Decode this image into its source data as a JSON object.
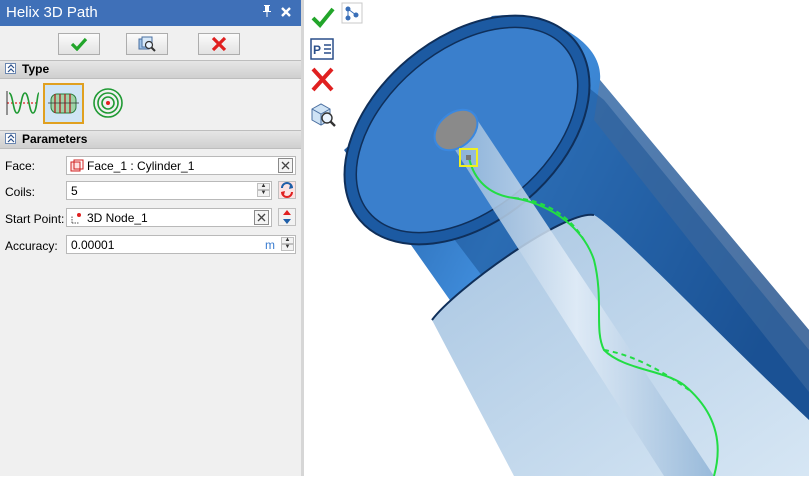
{
  "panel": {
    "title": "Helix 3D Path",
    "pin_glyph": "p",
    "close_glyph": "✖"
  },
  "actions": {
    "ok_icon": "green-check-icon",
    "preview_icon": "preview-magnifier-icon",
    "cancel_icon": "red-x-icon"
  },
  "sections": {
    "type_label": "Type",
    "parameters_label": "Parameters"
  },
  "type_options": [
    {
      "name": "linear-helix",
      "selected": false
    },
    {
      "name": "cylindrical-helix",
      "selected": true
    },
    {
      "name": "spiral-helix",
      "selected": false
    }
  ],
  "params": {
    "face_label": "Face:",
    "face_value": "Face_1 : Cylinder_1",
    "coils_label": "Coils:",
    "coils_value": "5",
    "start_label": "Start Point:",
    "start_value": "3D Node_1",
    "accuracy_label": "Accuracy:",
    "accuracy_value": "0.00001",
    "accuracy_unit": "m"
  },
  "colors": {
    "title_bar": "#3f70b8",
    "cylinder": "#1f5fa8",
    "helix": "#22dd44",
    "selection": "#f0f020"
  }
}
